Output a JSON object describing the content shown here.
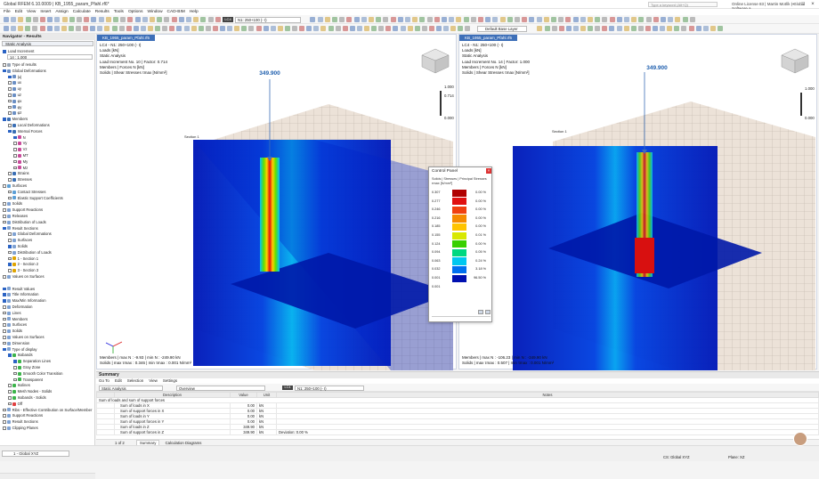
{
  "window": {
    "title": "Global RFEM 6.10.0009 | KB_1955_param_Pfahl.rf6*",
    "search_placeholder": "Type a keyword (Alt+Q)",
    "license": "Online License 83 | Martin Motlík | Global Software a..."
  },
  "menu": [
    "File",
    "Edit",
    "View",
    "Insert",
    "Assign",
    "Calculate",
    "Results",
    "Tools",
    "Options",
    "Window",
    "CAD-BIM",
    "Help"
  ],
  "toolbar": {
    "load_case_badge": "LC4",
    "load_case_combo": "N1: 250+100 (- I)",
    "base_layer": "Default Base Layer"
  },
  "navigator": {
    "title": "Navigator - Results",
    "combo": "Static Analysis",
    "load_increment_label": "Load Increment",
    "load_increment_value": "14 : 1.000",
    "items": [
      {
        "label": "Type of results",
        "level": 0,
        "cb": false,
        "color": "#9aa6b6"
      },
      {
        "label": "Global Deformations",
        "level": 0,
        "cb": true,
        "color": "#6b8fc4"
      },
      {
        "label": "|u|",
        "level": 1,
        "cb": true,
        "color": "#6b8fc4"
      },
      {
        "label": "ux",
        "level": 1,
        "cb": false,
        "color": "#6b8fc4"
      },
      {
        "label": "uy",
        "level": 1,
        "cb": false,
        "color": "#6b8fc4"
      },
      {
        "label": "uz",
        "level": 1,
        "cb": false,
        "color": "#6b8fc4"
      },
      {
        "label": "φx",
        "level": 1,
        "cb": false,
        "color": "#6b8fc4"
      },
      {
        "label": "φy",
        "level": 1,
        "cb": false,
        "color": "#6b8fc4"
      },
      {
        "label": "φz",
        "level": 1,
        "cb": false,
        "color": "#6b8fc4"
      },
      {
        "label": "Members",
        "level": 0,
        "cb": true,
        "color": "#3b6fb4"
      },
      {
        "label": "Local Deformations",
        "level": 1,
        "cb": false,
        "color": "#3b6fb4"
      },
      {
        "label": "Internal Forces",
        "level": 1,
        "cb": true,
        "color": "#3b6fb4"
      },
      {
        "label": "N",
        "level": 2,
        "cb": true,
        "color": "#c94b9b"
      },
      {
        "label": "Vy",
        "level": 2,
        "cb": false,
        "color": "#c94b9b"
      },
      {
        "label": "Vz",
        "level": 2,
        "cb": false,
        "color": "#c94b9b"
      },
      {
        "label": "MT",
        "level": 2,
        "cb": false,
        "color": "#c94b9b"
      },
      {
        "label": "My",
        "level": 2,
        "cb": false,
        "color": "#c94b9b"
      },
      {
        "label": "Mz",
        "level": 2,
        "cb": false,
        "color": "#c94b9b"
      },
      {
        "label": "Strains",
        "level": 1,
        "cb": false,
        "color": "#3b6fb4"
      },
      {
        "label": "Stresses",
        "level": 1,
        "cb": false,
        "color": "#3b6fb4"
      },
      {
        "label": "Surfaces",
        "level": 0,
        "cb": false,
        "color": "#5c9fd6"
      },
      {
        "label": "Contact Stresses",
        "level": 1,
        "cb": false,
        "color": "#5c9fd6"
      },
      {
        "label": "Elastic Support Coefficients",
        "level": 1,
        "cb": false,
        "color": "#5c9fd6"
      },
      {
        "label": "Solids",
        "level": 0,
        "cb": false,
        "color": "#7fa2d2"
      },
      {
        "label": "Support Reactions",
        "level": 0,
        "cb": false,
        "color": "#7fa2d2"
      },
      {
        "label": "Releases",
        "level": 0,
        "cb": false,
        "color": "#7fa2d2"
      },
      {
        "label": "Distribution of Loads",
        "level": 0,
        "cb": false,
        "color": "#7fa2d2"
      },
      {
        "label": "Result Sections",
        "level": 0,
        "cb": true,
        "color": "#7fa2d2"
      },
      {
        "label": "Global Deformations",
        "level": 1,
        "cb": false,
        "color": "#7fa2d2"
      },
      {
        "label": "Surfaces",
        "level": 1,
        "cb": false,
        "color": "#7fa2d2"
      },
      {
        "label": "Solids",
        "level": 1,
        "cb": true,
        "color": "#7fa2d2"
      },
      {
        "label": "Distribution of Loads",
        "level": 1,
        "cb": false,
        "color": "#7fa2d2"
      },
      {
        "label": "1 - Section 1",
        "level": 1,
        "cb": false,
        "color": "#e0a400"
      },
      {
        "label": "2 - Section 2",
        "level": 1,
        "cb": true,
        "color": "#e0a400"
      },
      {
        "label": "3 - Section 3",
        "level": 1,
        "cb": false,
        "color": "#e0a400"
      },
      {
        "label": "Values on Surfaces",
        "level": 0,
        "cb": false,
        "color": "#7fa2d2"
      },
      {
        "label": "",
        "level": 0,
        "cb": false,
        "color": "#ffffff"
      },
      {
        "label": "Result Values",
        "level": 0,
        "cb": true,
        "color": "#7fa2d2"
      },
      {
        "label": "Title Information",
        "level": 0,
        "cb": true,
        "color": "#7fa2d2"
      },
      {
        "label": "Max/Min Information",
        "level": 0,
        "cb": true,
        "color": "#7fa2d2"
      },
      {
        "label": "Deformation",
        "level": 0,
        "cb": false,
        "color": "#7fa2d2"
      },
      {
        "label": "Lines",
        "level": 0,
        "cb": false,
        "color": "#7fa2d2"
      },
      {
        "label": "Members",
        "level": 0,
        "cb": false,
        "color": "#7fa2d2"
      },
      {
        "label": "Surfaces",
        "level": 0,
        "cb": false,
        "color": "#7fa2d2"
      },
      {
        "label": "Solids",
        "level": 0,
        "cb": false,
        "color": "#7fa2d2"
      },
      {
        "label": "Values on Surfaces",
        "level": 0,
        "cb": false,
        "color": "#7fa2d2"
      },
      {
        "label": "Dimension",
        "level": 0,
        "cb": false,
        "color": "#7fa2d2"
      },
      {
        "label": "Type of display",
        "level": 0,
        "cb": true,
        "color": "#7fa2d2"
      },
      {
        "label": "Isobands",
        "level": 1,
        "cb": true,
        "color": "#3cb44b"
      },
      {
        "label": "Separation Lines",
        "level": 2,
        "cb": true,
        "color": "#3cb44b"
      },
      {
        "label": "Gray Zone",
        "level": 2,
        "cb": false,
        "color": "#3cb44b"
      },
      {
        "label": "Smooth Color Transition",
        "level": 2,
        "cb": false,
        "color": "#3cb44b"
      },
      {
        "label": "Transparent",
        "level": 2,
        "cb": false,
        "color": "#3cb44b"
      },
      {
        "label": "Isolines",
        "level": 1,
        "cb": false,
        "color": "#3cb44b"
      },
      {
        "label": "Mesh Nodes - Solids",
        "level": 1,
        "cb": false,
        "color": "#3cb44b"
      },
      {
        "label": "Isobands - Solids",
        "level": 1,
        "cb": false,
        "color": "#3cb44b"
      },
      {
        "label": "Off",
        "level": 1,
        "cb": false,
        "color": "#e04040"
      },
      {
        "label": "Ribs - Effective Contribution on Surface/Member",
        "level": 0,
        "cb": false,
        "color": "#7fa2d2"
      },
      {
        "label": "Support Reactions",
        "level": 0,
        "cb": false,
        "color": "#7fa2d2"
      },
      {
        "label": "Result Sections",
        "level": 0,
        "cb": false,
        "color": "#7fa2d2"
      },
      {
        "label": "Clipping Planes",
        "level": 0,
        "cb": false,
        "color": "#7fa2d2"
      }
    ]
  },
  "viewport_left": {
    "tab": "KB_1955_param_Pfahl.rf6",
    "info": [
      "LC4 - N1: 250+100 (- I)",
      "Loads [kN]",
      "Static Analysis",
      "Load Increment No. 10 | Factor: 0.714",
      "Members | Forces N [kN]",
      "Solids | Shear Stresses τmax [N/mm²]"
    ],
    "load_value": "349.900",
    "scale_top": "1.000",
    "scale_mid": "0.714",
    "scale_bottom": "0.000",
    "section_label": "Section 1",
    "footer": [
      "Members | max N : -9.93 | min N : -249.90 kN",
      "Solids | max τmax : 0.346 | min τmax : 0.001 N/mm²"
    ]
  },
  "viewport_right": {
    "tab": "KB_1955_param_Pfahl.rf6",
    "info": [
      "LC4 - N1: 250+100 (- I)",
      "Loads [kN]",
      "Static Analysis",
      "Load Increment No. 14 | Factor: 1.000",
      "Members | Forces N [kN]",
      "Solids | Shear Stresses τmax [N/mm²]"
    ],
    "load_value": "349.900",
    "scale_top": "1.000",
    "scale_bottom": "0.000",
    "section_label": "Section 1",
    "footer": [
      "Members | max N : -106.23 | min N : -349.90 kN",
      "Solids | max τmax : 0.507 | min τmax : 0.001 N/mm²"
    ]
  },
  "control_panel": {
    "title": "Control Panel",
    "subtitle": "Solids | Stresses | Principal Stresses",
    "unit": "τmax [N/mm²]",
    "legend": [
      {
        "value": "0.307",
        "color": "#b00000",
        "percent": "0.00 %"
      },
      {
        "value": "0.277",
        "color": "#e01010",
        "percent": "0.00 %"
      },
      {
        "value": "0.246",
        "color": "#f04010",
        "percent": "0.00 %"
      },
      {
        "value": "0.216",
        "color": "#f58a00",
        "percent": "0.00 %"
      },
      {
        "value": "0.185",
        "color": "#ffc400",
        "percent": "0.00 %"
      },
      {
        "value": "0.155",
        "color": "#d8e800",
        "percent": "0.01 %"
      },
      {
        "value": "0.124",
        "color": "#38d000",
        "percent": "0.00 %"
      },
      {
        "value": "0.094",
        "color": "#00d880",
        "percent": "0.05 %"
      },
      {
        "value": "0.063",
        "color": "#00c8f0",
        "percent": "0.24 %"
      },
      {
        "value": "0.032",
        "color": "#0070f0",
        "percent": "3.18 %"
      },
      {
        "value": "0.001",
        "color": "#0010b0",
        "percent": "96.50 %"
      }
    ],
    "legend_bottom": "0.001"
  },
  "summary": {
    "title": "Summary",
    "menu": [
      "Go To",
      "Edit",
      "Selection",
      "View",
      "Settings"
    ],
    "analysis_combo": "Static Analysis",
    "overview_combo": "Overview",
    "lc_badge": "LC4",
    "lc_combo": "N1: 250+100 (- I)",
    "headers": [
      "Description",
      "Value",
      "Unit",
      "Notes"
    ],
    "group": "Sum of loads and sum of support forces",
    "rows": [
      {
        "d": "Sum of loads in X",
        "v": "0.00",
        "u": "kN",
        "n": ""
      },
      {
        "d": "Sum of support forces in X",
        "v": "0.00",
        "u": "kN",
        "n": ""
      },
      {
        "d": "Sum of loads in Y",
        "v": "0.00",
        "u": "kN",
        "n": ""
      },
      {
        "d": "Sum of support forces in Y",
        "v": "0.00",
        "u": "kN",
        "n": ""
      },
      {
        "d": "Sum of loads in Z",
        "v": "349.90",
        "u": "kN",
        "n": ""
      },
      {
        "d": "Sum of support forces in Z",
        "v": "349.90",
        "u": "kN",
        "n": "Deviation: 0.00 %"
      }
    ],
    "pager": "1 of 2",
    "tabs": [
      "Summary",
      "Calculation Diagrams"
    ]
  },
  "status": {
    "view_combo": "1 - Global XYZ",
    "cs": "CS: Global XYZ",
    "plane": "Plane: XZ"
  }
}
